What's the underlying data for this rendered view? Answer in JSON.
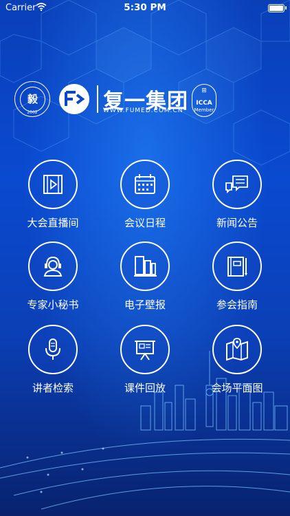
{
  "status_bar": {
    "carrier": "Carrier",
    "time": "5:30 PM"
  },
  "header": {
    "seal_char": "毅",
    "seal_year": "2002",
    "brand_name": "复一集团",
    "brand_url": "WWW.FUMED.COM.CN",
    "icca_line1": "ICCA",
    "icca_line2": "Member"
  },
  "menu": [
    {
      "label": "大会直播间",
      "icon": "video-icon"
    },
    {
      "label": "会议日程",
      "icon": "calendar-icon"
    },
    {
      "label": "新闻公告",
      "icon": "chat-bubbles-icon"
    },
    {
      "label": "专家小秘书",
      "icon": "headset-person-icon"
    },
    {
      "label": "电子壁报",
      "icon": "display-boards-icon"
    },
    {
      "label": "参会指南",
      "icon": "guide-book-icon"
    },
    {
      "label": "讲者检索",
      "icon": "microphone-icon"
    },
    {
      "label": "课件回放",
      "icon": "presentation-icon"
    },
    {
      "label": "会场平面图",
      "icon": "map-pin-icon"
    }
  ],
  "colors": {
    "background": "#0a44c4",
    "accent": "#ffffff"
  }
}
